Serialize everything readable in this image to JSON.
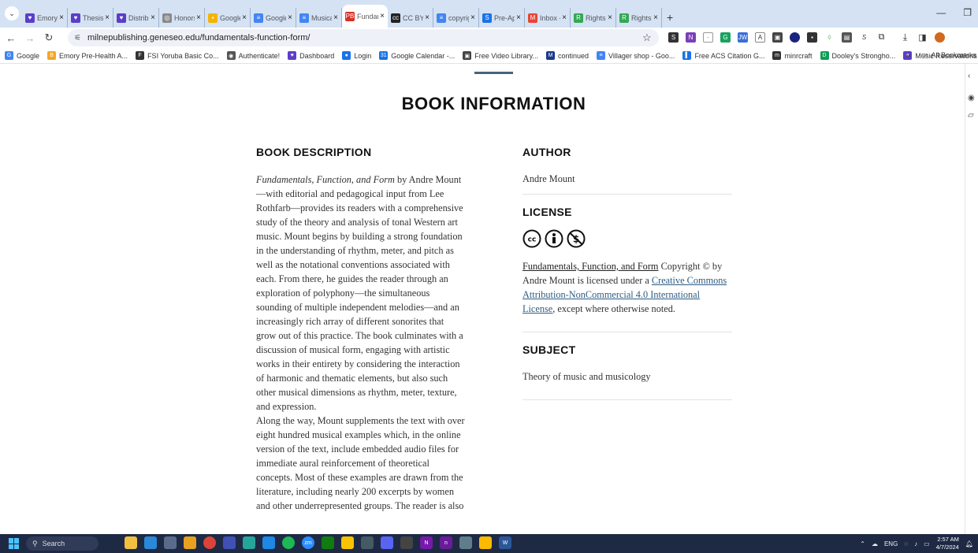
{
  "browser": {
    "tabs": [
      {
        "label": "Emory C",
        "color": "#5b3ec8",
        "glyph": "♥"
      },
      {
        "label": "Thesis P",
        "color": "#5b3ec8",
        "glyph": "♥"
      },
      {
        "label": "Distribut",
        "color": "#5b3ec8",
        "glyph": "♥"
      },
      {
        "label": "Honors",
        "color": "#8a8a8a",
        "glyph": "◎"
      },
      {
        "label": "Google",
        "color": "#f4b400",
        "glyph": "▪"
      },
      {
        "label": "Google",
        "color": "#4285f4",
        "glyph": "≡"
      },
      {
        "label": "Musical",
        "color": "#4285f4",
        "glyph": "≡"
      },
      {
        "label": "Fundam",
        "color": "#d93025",
        "glyph": "PB"
      },
      {
        "label": "CC BY-N",
        "color": "#222222",
        "glyph": "cc"
      },
      {
        "label": "copyrigh",
        "color": "#4285f4",
        "glyph": "≡"
      },
      {
        "label": "Pre-App",
        "color": "#1a73e8",
        "glyph": "S"
      },
      {
        "label": "Inbox -",
        "color": "#ea4335",
        "glyph": "M"
      },
      {
        "label": "RightsLi",
        "color": "#34a853",
        "glyph": "R"
      },
      {
        "label": "RightsLi",
        "color": "#34a853",
        "glyph": "R"
      }
    ],
    "active_tab": 7,
    "new_tab_glyph": "+",
    "url": "milnepublishing.geneseo.edu/fundamentals-function-form/",
    "bookmarks": [
      {
        "label": "Google",
        "color": "#4285f4",
        "glyph": "G"
      },
      {
        "label": "Emory Pre-Health A...",
        "color": "#f5a623",
        "glyph": "B"
      },
      {
        "label": "FSI Yoruba Basic Co...",
        "color": "#333333",
        "glyph": "F"
      },
      {
        "label": "Authenticate!",
        "color": "#555555",
        "glyph": "◉"
      },
      {
        "label": "Dashboard",
        "color": "#5b3ec8",
        "glyph": "♥"
      },
      {
        "label": "Login",
        "color": "#1a73e8",
        "glyph": "●"
      },
      {
        "label": "Google Calendar -...",
        "color": "#1a73e8",
        "glyph": "31"
      },
      {
        "label": "Free Video Library...",
        "color": "#444444",
        "glyph": "▣"
      },
      {
        "label": "continued",
        "color": "#1a3a8a",
        "glyph": "M"
      },
      {
        "label": "Villager shop - Goo...",
        "color": "#4285f4",
        "glyph": "≡"
      },
      {
        "label": "Free ACS Citation G...",
        "color": "#1a73e8",
        "glyph": "▌"
      },
      {
        "label": "minrcraft",
        "color": "#333333",
        "glyph": "m"
      },
      {
        "label": "Dooley's Strongho...",
        "color": "#0f9d58",
        "glyph": "D"
      },
      {
        "label": "Music Reservations",
        "color": "#5b3ec8",
        "glyph": "♥"
      }
    ],
    "bookmarks_more": "»",
    "all_bookmarks": "All Bookmarks"
  },
  "page": {
    "heading": "BOOK INFORMATION",
    "description": {
      "title": "BOOK DESCRIPTION",
      "book_title": "Fundamentals, Function, and Form",
      "para1_rest": " by Andre Mount—with editorial and pedagogical input from Lee Rothfarb—provides its readers with a comprehensive study of the theory and analysis of tonal Western art music.  Mount begins by building a strong foundation in the understanding of rhythm, meter, and pitch as well as the notational conventions associated with each. From there, he guides the reader through an exploration of polyphony—the simultaneous sounding of multiple independent melodies—and an increasingly rich array of different sonorites that grow out of this practice. The book culminates with a discussion of musical form, engaging with artistic works in their entirety by considering the interaction of harmonic and thematic elements, but also such other musical dimensions as rhythm, meter, texture, and expression.",
      "para2": "Along the way, Mount supplements the text with over eight hundred musical examples which, in the online version of the text, include embedded audio files for immediate aural reinforcement of theoretical concepts. Most of these examples are drawn from the literature, including nearly 200 excerpts by women and other underrepresented groups. The reader is also"
    },
    "author": {
      "title": "AUTHOR",
      "name": "Andre Mount"
    },
    "license": {
      "title": "LICENSE",
      "book_link": "Fundamentals, Function, and Form",
      "text1": " Copyright © by Andre Mount is licensed under a ",
      "license_link": "Creative Commons Attribution-NonCommercial 4.0 International License",
      "text2": ", except where otherwise noted."
    },
    "subject": {
      "title": "SUBJECT",
      "value": "Theory of music and musicology"
    }
  },
  "taskbar": {
    "search_placeholder": "Search",
    "lang": "ENG",
    "time": "2:57 AM",
    "date": "4/7/2024"
  }
}
